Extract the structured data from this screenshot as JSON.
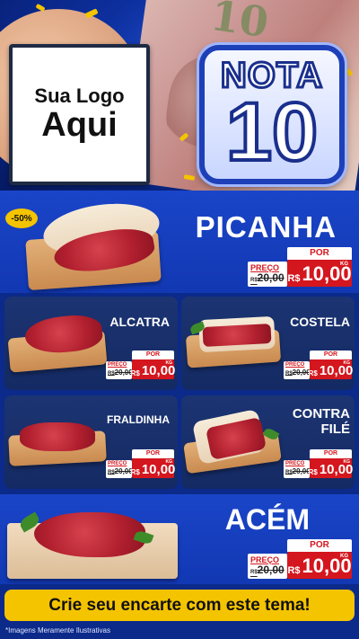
{
  "brand": {
    "logo_line1": "Sua Logo",
    "logo_line2": "Aqui",
    "nota_word": "NOTA",
    "nota_number": "10"
  },
  "money_number": "10",
  "discount_badge": "-50%",
  "featured": {
    "name": "PICANHA",
    "por": "POR",
    "preco_label": "PREÇO",
    "old_cur": "R$",
    "old_price": "20,00",
    "currency": "R$",
    "price": "10,00",
    "unit": "KG"
  },
  "grid": [
    {
      "name": "ALCATRA",
      "por": "POR",
      "preco_label": "PREÇO",
      "old_cur": "R$",
      "old_price": "20,00",
      "currency": "R$",
      "price": "10,00",
      "unit": "KG"
    },
    {
      "name": "COSTELA",
      "por": "POR",
      "preco_label": "PREÇO",
      "old_cur": "R$",
      "old_price": "20,00",
      "currency": "R$",
      "price": "10,00",
      "unit": "KG"
    },
    {
      "name": "FRALDINHA",
      "por": "POR",
      "preco_label": "PREÇO",
      "old_cur": "R$",
      "old_price": "20,00",
      "currency": "R$",
      "price": "10,00",
      "unit": "KG"
    },
    {
      "name_line1": "CONTRA",
      "name_line2": "FILÉ",
      "por": "POR",
      "preco_label": "PREÇO",
      "old_cur": "R$",
      "old_price": "20,00",
      "currency": "R$",
      "price": "10,00",
      "unit": "KG"
    }
  ],
  "bottom": {
    "name": "ACÉM",
    "por": "POR",
    "preco_label": "PREÇO",
    "old_cur": "R$",
    "old_price": "20,00",
    "currency": "R$",
    "price": "10,00",
    "unit": "KG"
  },
  "cta": "Crie seu encarte com este tema!",
  "disclaimer": "*Imagens Meramente Ilustrativas",
  "colors": {
    "brand_blue": "#0d2f9e",
    "accent_yellow": "#f5c400",
    "price_red": "#d4161e"
  }
}
